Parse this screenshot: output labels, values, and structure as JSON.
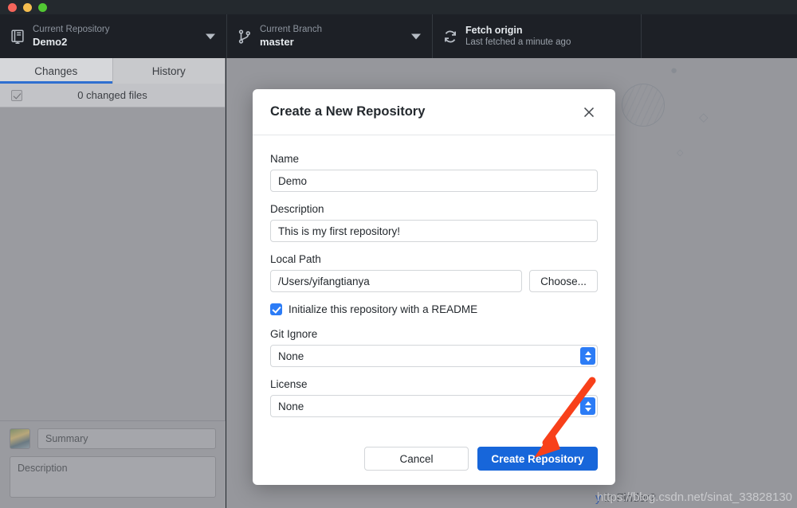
{
  "window": {
    "traffic_lights": [
      {
        "name": "close",
        "color": "#f5655b"
      },
      {
        "name": "minimize",
        "color": "#f5bd4f"
      },
      {
        "name": "maximize",
        "color": "#52c833"
      }
    ]
  },
  "toolbar": {
    "repository": {
      "icon": "repo-book-icon",
      "sublabel": "Current Repository",
      "value": "Demo2",
      "caret": "chevron-down-icon"
    },
    "branch": {
      "icon": "git-branch-icon",
      "sublabel": "Current Branch",
      "value": "master",
      "caret": "chevron-down-icon"
    },
    "fetch": {
      "icon": "sync-icon",
      "title": "Fetch origin",
      "subtitle": "Last fetched a minute ago"
    }
  },
  "sidebar": {
    "tabs": [
      {
        "label": "Changes",
        "active": true
      },
      {
        "label": "History",
        "active": false
      }
    ],
    "changed_files_label": "0 changed files",
    "changed_files_count": 0,
    "commit": {
      "summary_placeholder": "Summary",
      "description_placeholder": "Description"
    }
  },
  "background": {
    "finder_link_fragment": "y",
    "finder_text": "in Finder?",
    "watermark": "https://blog.csdn.net/sinat_33828130",
    "decorations": [
      "planet-illustration",
      "sparkle",
      "diamond",
      "plus",
      "dashed-line"
    ]
  },
  "dialog": {
    "title": "Create a New Repository",
    "close_icon": "close-icon",
    "fields": {
      "name": {
        "label": "Name",
        "value": "Demo",
        "placeholder": ""
      },
      "description": {
        "label": "Description",
        "value": "This is my first repository!",
        "placeholder": ""
      },
      "local_path": {
        "label": "Local Path",
        "value": "/Users/yifangtianya",
        "placeholder": "",
        "button": "Choose..."
      },
      "readme": {
        "label": "Initialize this repository with a README",
        "checked": true
      },
      "git_ignore": {
        "label": "Git Ignore",
        "value": "None"
      },
      "license": {
        "label": "License",
        "value": "None"
      }
    },
    "buttons": {
      "cancel": "Cancel",
      "create": "Create Repository"
    }
  },
  "annotation": {
    "arrow_color": "#f8401a",
    "points_to": "create-repository-button"
  }
}
